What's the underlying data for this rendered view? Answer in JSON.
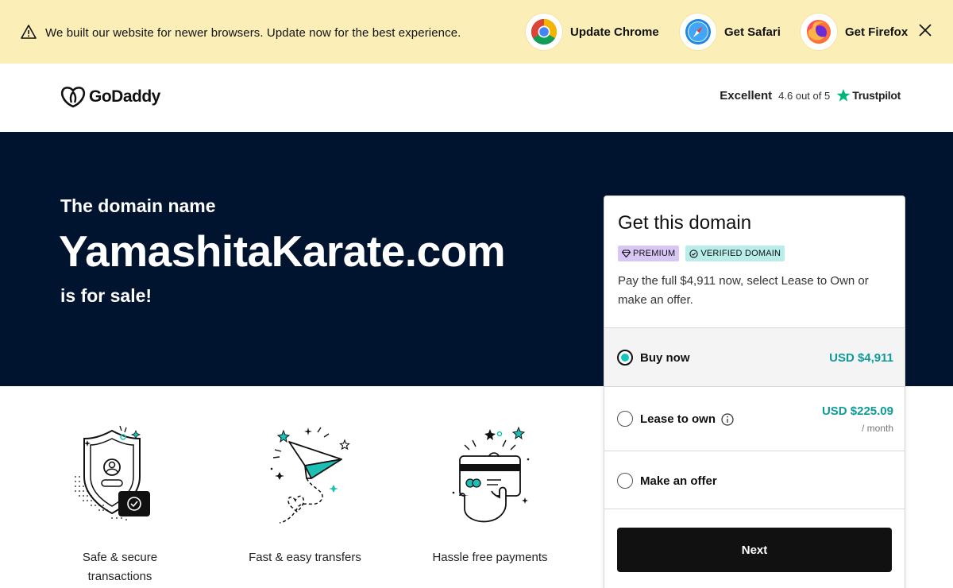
{
  "banner": {
    "message": "We built our website for newer browsers. Update now for the best experience.",
    "icons": {
      "warning": "warning-triangle-icon",
      "close": "close-icon"
    },
    "links": [
      {
        "label": "Update Chrome",
        "icon": "chrome-icon"
      },
      {
        "label": "Get Safari",
        "icon": "safari-icon"
      },
      {
        "label": "Get Firefox",
        "icon": "firefox-icon"
      }
    ]
  },
  "header": {
    "brand": "GoDaddy",
    "rating_word": "Excellent",
    "rating_score": "4.6 out of 5",
    "trust_brand": "Trustpilot",
    "colors": {
      "trustpilot_star": "#00b67a"
    }
  },
  "hero": {
    "pre": "The domain name",
    "domain": "YamashitaKarate.com",
    "post": "is for sale!",
    "background": "#00132f"
  },
  "features": [
    {
      "label": "Safe & secure transactions",
      "icon": "shield-icon"
    },
    {
      "label": "Fast & easy transfers",
      "icon": "paper-plane-icon"
    },
    {
      "label": "Hassle free payments",
      "icon": "payment-card-icon"
    }
  ],
  "card": {
    "title": "Get this domain",
    "badges": {
      "premium": "PREMIUM",
      "verified": "VERIFIED DOMAIN"
    },
    "description": "Pay the full $4,911 now, select Lease to Own or make an offer.",
    "options": [
      {
        "label": "Buy now",
        "price": "USD $4,911",
        "sub": "",
        "selected": true
      },
      {
        "label": "Lease to own",
        "price": "USD $225.09",
        "sub": "/ month",
        "selected": false
      },
      {
        "label": "Make an offer",
        "price": "",
        "sub": "",
        "selected": false
      }
    ],
    "next_label": "Next",
    "colors": {
      "accent": "#13c7c0",
      "price": "#0c9b99"
    }
  }
}
